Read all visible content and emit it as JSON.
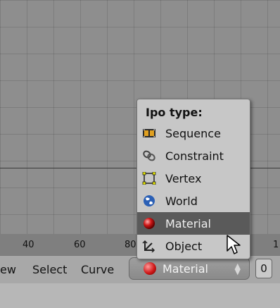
{
  "ruler": {
    "ticks": [
      "40",
      "60",
      "80",
      "1"
    ]
  },
  "header": {
    "menu_view": "ew",
    "menu_select": "Select",
    "menu_curve": "Curve",
    "ipo_type_value": "Material",
    "number_value": "0"
  },
  "popup": {
    "title": "Ipo type:",
    "items": [
      {
        "label": "Sequence",
        "icon": "sequence-icon"
      },
      {
        "label": "Constraint",
        "icon": "constraint-icon"
      },
      {
        "label": "Vertex",
        "icon": "vertex-icon"
      },
      {
        "label": "World",
        "icon": "world-icon"
      },
      {
        "label": "Material",
        "icon": "material-icon",
        "selected": true
      },
      {
        "label": "Object",
        "icon": "object-icon"
      }
    ]
  },
  "colors": {
    "selected_item": "#5a5a5a",
    "material_ball": "#d01818",
    "popup_bg": "#c7c7c7"
  }
}
